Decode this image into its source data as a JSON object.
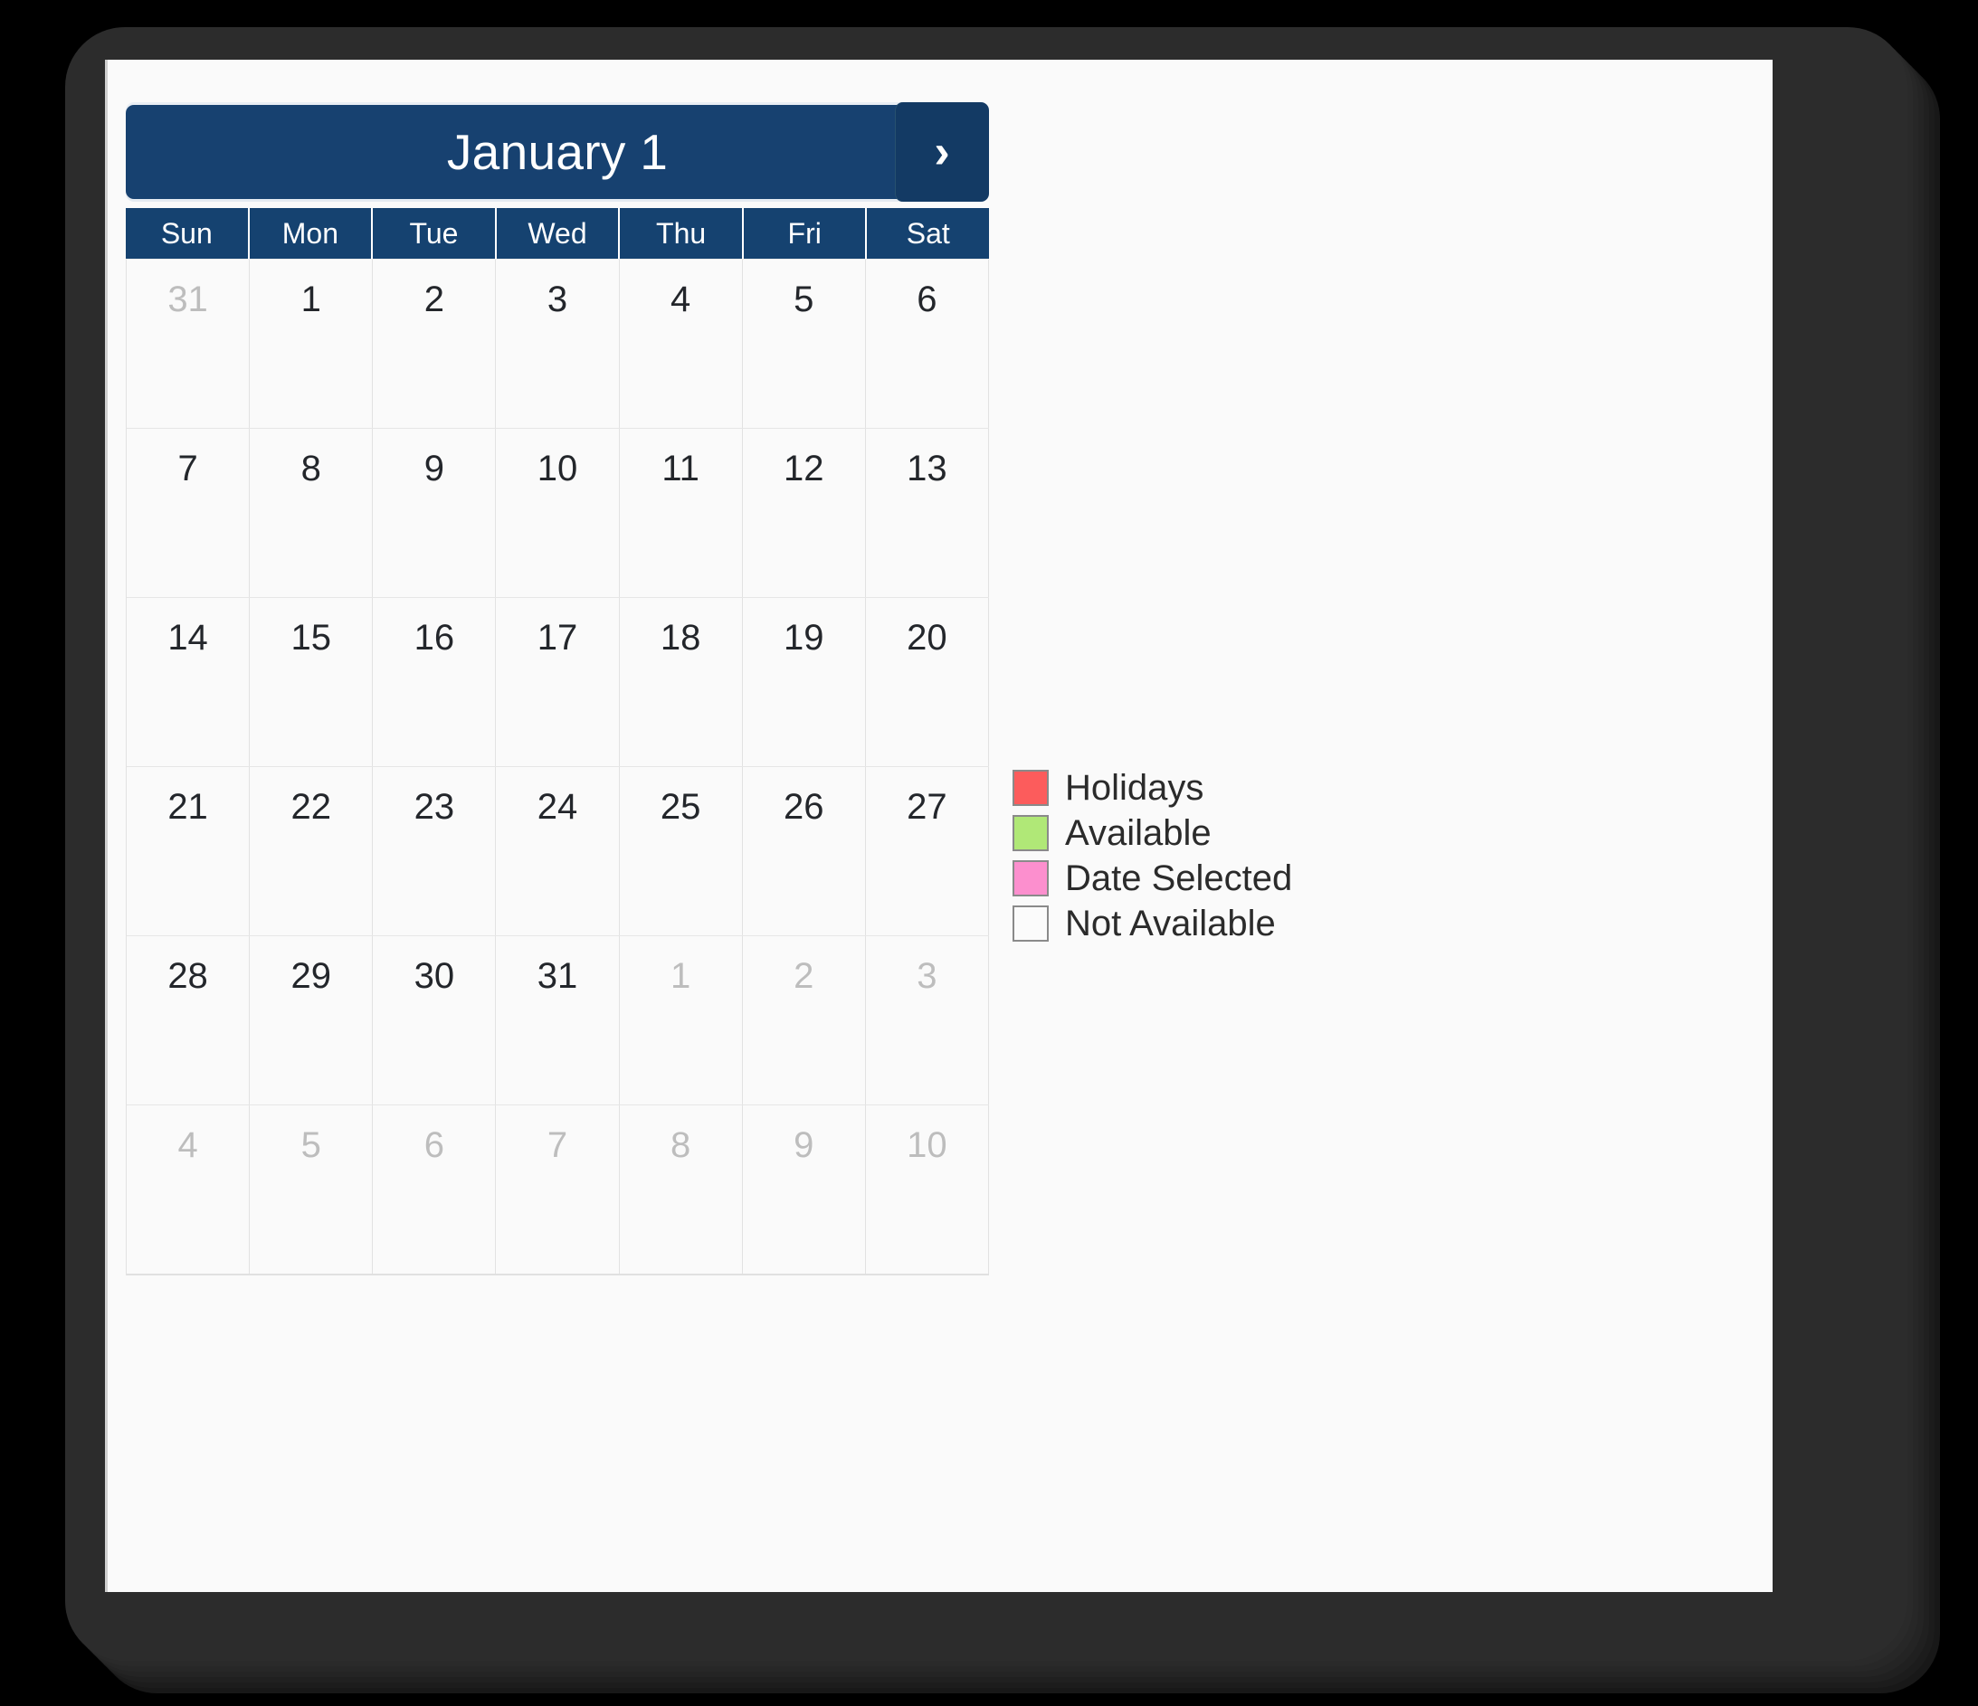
{
  "calendar": {
    "title": "January 1",
    "next_button": {
      "icon": "chevron-right-icon",
      "glyph": "›",
      "label": "Next month"
    },
    "weekdays": [
      "Sun",
      "Mon",
      "Tue",
      "Wed",
      "Thu",
      "Fri",
      "Sat"
    ],
    "weeks": [
      [
        {
          "day": "31",
          "other_month": true
        },
        {
          "day": "1",
          "other_month": false
        },
        {
          "day": "2",
          "other_month": false
        },
        {
          "day": "3",
          "other_month": false
        },
        {
          "day": "4",
          "other_month": false
        },
        {
          "day": "5",
          "other_month": false
        },
        {
          "day": "6",
          "other_month": false
        }
      ],
      [
        {
          "day": "7",
          "other_month": false
        },
        {
          "day": "8",
          "other_month": false
        },
        {
          "day": "9",
          "other_month": false
        },
        {
          "day": "10",
          "other_month": false
        },
        {
          "day": "11",
          "other_month": false
        },
        {
          "day": "12",
          "other_month": false
        },
        {
          "day": "13",
          "other_month": false
        }
      ],
      [
        {
          "day": "14",
          "other_month": false
        },
        {
          "day": "15",
          "other_month": false
        },
        {
          "day": "16",
          "other_month": false
        },
        {
          "day": "17",
          "other_month": false
        },
        {
          "day": "18",
          "other_month": false
        },
        {
          "day": "19",
          "other_month": false
        },
        {
          "day": "20",
          "other_month": false
        }
      ],
      [
        {
          "day": "21",
          "other_month": false
        },
        {
          "day": "22",
          "other_month": false
        },
        {
          "day": "23",
          "other_month": false
        },
        {
          "day": "24",
          "other_month": false
        },
        {
          "day": "25",
          "other_month": false
        },
        {
          "day": "26",
          "other_month": false
        },
        {
          "day": "27",
          "other_month": false
        }
      ],
      [
        {
          "day": "28",
          "other_month": false
        },
        {
          "day": "29",
          "other_month": false
        },
        {
          "day": "30",
          "other_month": false
        },
        {
          "day": "31",
          "other_month": false
        },
        {
          "day": "1",
          "other_month": true
        },
        {
          "day": "2",
          "other_month": true
        },
        {
          "day": "3",
          "other_month": true
        }
      ],
      [
        {
          "day": "4",
          "other_month": true
        },
        {
          "day": "5",
          "other_month": true
        },
        {
          "day": "6",
          "other_month": true
        },
        {
          "day": "7",
          "other_month": true
        },
        {
          "day": "8",
          "other_month": true
        },
        {
          "day": "9",
          "other_month": true
        },
        {
          "day": "10",
          "other_month": true
        }
      ]
    ]
  },
  "legend": {
    "items": [
      {
        "label": "Holidays",
        "color": "#fc5c5c"
      },
      {
        "label": "Available",
        "color": "#b0e877"
      },
      {
        "label": "Date Selected",
        "color": "#fc8fce"
      },
      {
        "label": "Not Available",
        "color": "#fbfbfb"
      }
    ]
  },
  "theme": {
    "header_navy": "#174170",
    "weekday_navy": "#154270",
    "page_background": "#fafafa",
    "bezel": "#2c2c2c",
    "day_text": "#23262b",
    "other_month_text": "#bdbdbd"
  }
}
